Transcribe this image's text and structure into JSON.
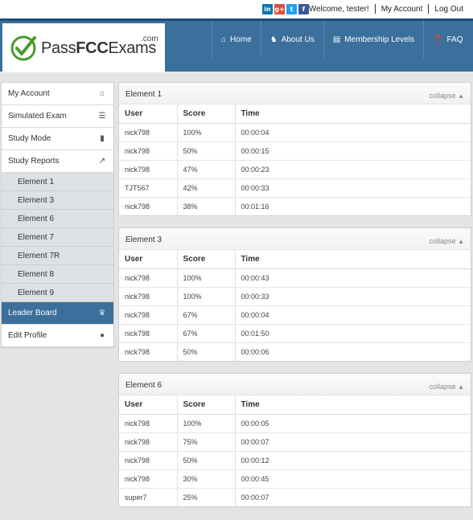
{
  "topbar": {
    "socials": [
      {
        "name": "linkedin-icon",
        "glyph": "in"
      },
      {
        "name": "google-plus-icon",
        "glyph": "g+"
      },
      {
        "name": "twitter-icon",
        "glyph": "t"
      },
      {
        "name": "facebook-icon",
        "glyph": "f"
      }
    ],
    "welcome": "Welcome, tester!",
    "my_account": "My Account",
    "log_out": "Log Out"
  },
  "logo": {
    "text_light": "Pass",
    "text_bold": "FCC",
    "text_rest": "Exams",
    "dotcom": ".com"
  },
  "nav": {
    "home": "Home",
    "about": "About Us",
    "membership": "Membership Levels",
    "faq": "FAQ"
  },
  "sidebar": {
    "my_account": "My Account",
    "simulated_exam": "Simulated Exam",
    "study_mode": "Study Mode",
    "study_reports": "Study Reports",
    "subitems": [
      "Element 1",
      "Element 3",
      "Element 6",
      "Element 7",
      "Element 7R",
      "Element 8",
      "Element 9"
    ],
    "leader_board": "Leader Board",
    "edit_profile": "Edit Profile"
  },
  "panels": [
    {
      "title": "Element 1",
      "collapse": "collapse",
      "headers": [
        "User",
        "Score",
        "Time"
      ],
      "rows": [
        [
          "nick798",
          "100%",
          "00:00:04"
        ],
        [
          "nick798",
          "50%",
          "00:00:15"
        ],
        [
          "nick798",
          "47%",
          "00:00:23"
        ],
        [
          "TJT567",
          "42%",
          "00:00:33"
        ],
        [
          "nick798",
          "38%",
          "00:01:16"
        ]
      ]
    },
    {
      "title": "Element 3",
      "collapse": "collapse",
      "headers": [
        "User",
        "Score",
        "Time"
      ],
      "rows": [
        [
          "nick798",
          "100%",
          "00:00:43"
        ],
        [
          "nick798",
          "100%",
          "00:00:33"
        ],
        [
          "nick798",
          "67%",
          "00:00:04"
        ],
        [
          "nick798",
          "67%",
          "00:01:50"
        ],
        [
          "nick798",
          "50%",
          "00:00:06"
        ]
      ]
    },
    {
      "title": "Element 6",
      "collapse": "collapse",
      "headers": [
        "User",
        "Score",
        "Time"
      ],
      "rows": [
        [
          "nick798",
          "100%",
          "00:00:05"
        ],
        [
          "nick798",
          "75%",
          "00:00:07"
        ],
        [
          "nick798",
          "50%",
          "00:00:12"
        ],
        [
          "nick798",
          "30%",
          "00:00:45"
        ],
        [
          "super7",
          "25%",
          "00:00:07"
        ]
      ]
    }
  ],
  "colors": {
    "header_blue": "#3b6f9c",
    "active_blue": "#3b6f9c",
    "logo_green": "#4a9a2c"
  }
}
